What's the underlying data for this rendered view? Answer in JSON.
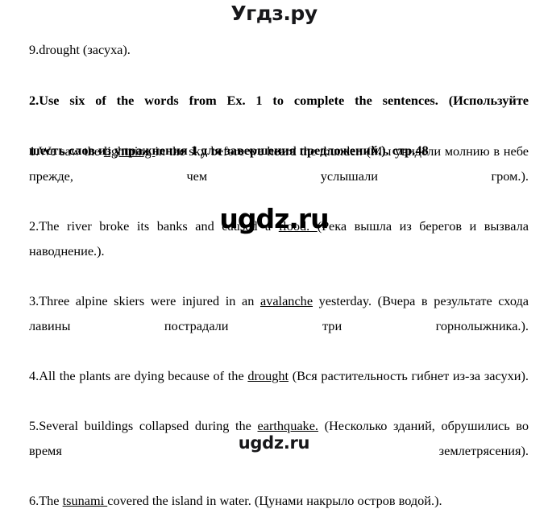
{
  "watermarks": {
    "top": "Угдз.ру",
    "middle": "ugdz.ru",
    "bottom": "ugdz.ru"
  },
  "document": {
    "lead_item": "9.drought (засуха).",
    "heading": {
      "line1": "2.Use six of the words from Ex. 1 to complete the sentences. (Используйте",
      "line2": "шесть слов из упражнения 1 для завершения предложений.). стр.48"
    },
    "exercises": [
      {
        "number": "1.",
        "before": "We saw the ",
        "answer": "lightning ",
        "after": " in the sky before we heard the thunder. (Мы увидели молнию в небе прежде, чем услышали гром.)."
      },
      {
        "number": "2.",
        "before": "The river broke its banks and caused a ",
        "answer": "flood. ",
        "after": "(Река вышла из берегов и вызвала наводнение.)."
      },
      {
        "number": "3.",
        "before": "Three alpine skiers were injured in an ",
        "answer": "avalanche",
        "after": " yesterday. (Вчера в результате схода лавины пострадали три горнолыжника.)."
      },
      {
        "number": "4.",
        "before": "All the plants are dying because of the ",
        "answer": "drought",
        "after": " (Вся растительность гибнет из-за засухи)."
      },
      {
        "number": "5.",
        "before": "Several buildings collapsed during the ",
        "answer": "earthquake.",
        "after": " (Несколько зданий, обрушились во время землетрясения)."
      },
      {
        "number": "6.",
        "before": "The ",
        "answer": "tsunami ",
        "after": "covered the island in water. (Цунами накрыло остров водой.)."
      }
    ]
  }
}
